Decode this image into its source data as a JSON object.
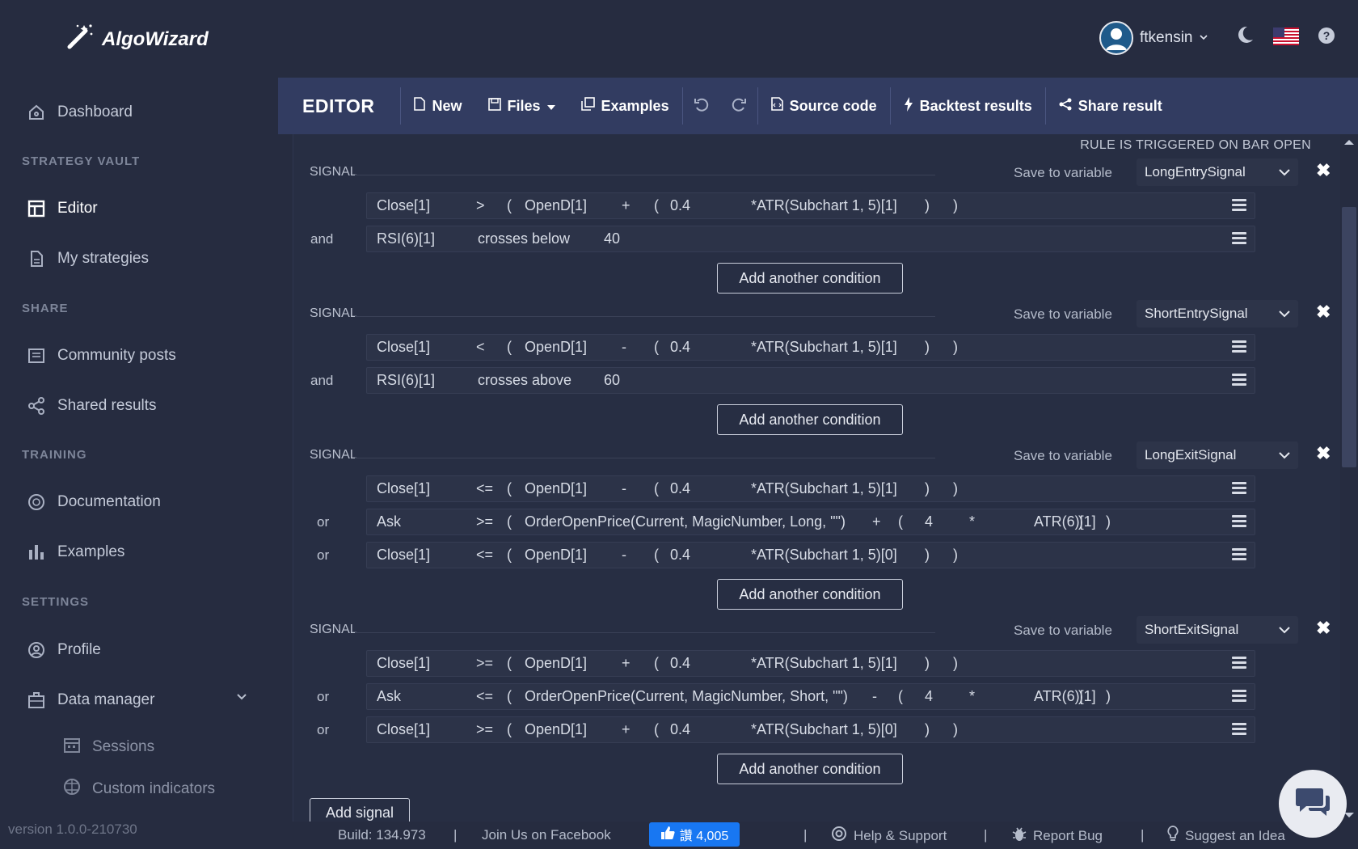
{
  "brand": {
    "name": "AlgoWizard"
  },
  "sidebar": {
    "items": [
      {
        "label": "Dashboard"
      },
      {
        "section": "STRATEGY VAULT"
      },
      {
        "label": "Editor"
      },
      {
        "label": "My strategies"
      },
      {
        "section": "SHARE"
      },
      {
        "label": "Community posts"
      },
      {
        "label": "Shared results"
      },
      {
        "section": "TRAINING"
      },
      {
        "label": "Documentation"
      },
      {
        "label": "Examples"
      },
      {
        "section": "SETTINGS"
      },
      {
        "label": "Profile"
      },
      {
        "label": "Data manager"
      },
      {
        "label": "Sessions"
      },
      {
        "label": "Custom indicators"
      }
    ],
    "version": "version 1.0.0-210730"
  },
  "header": {
    "username": "ftkensin"
  },
  "toolbar": {
    "title": "EDITOR",
    "new": "New",
    "files": "Files",
    "examples": "Examples",
    "source": "Source code",
    "backtest": "Backtest results",
    "share": "Share result"
  },
  "editor": {
    "trigger_note": "RULE IS TRIGGERED ON BAR OPEN",
    "signal_label": "SIGNAL",
    "save_label": "Save to variable",
    "add_condition": "Add another condition",
    "add_signal": "Add signal",
    "signals": [
      {
        "variable": "LongEntrySignal",
        "conditions": [
          {
            "conj": "",
            "tokens": [
              "Close[1]",
              ">",
              "(",
              "OpenD[1]",
              "+",
              "(",
              "0.4",
              "*",
              "ATR(Subchart 1, 5)[1]",
              ")",
              ")"
            ]
          },
          {
            "conj": "and",
            "tokens": [
              "RSI(6)[1]",
              "crosses below",
              "40"
            ]
          }
        ]
      },
      {
        "variable": "ShortEntrySignal",
        "conditions": [
          {
            "conj": "",
            "tokens": [
              "Close[1]",
              "<",
              "(",
              "OpenD[1]",
              "-",
              "(",
              "0.4",
              "*",
              "ATR(Subchart 1, 5)[1]",
              ")",
              ")"
            ]
          },
          {
            "conj": "and",
            "tokens": [
              "RSI(6)[1]",
              "crosses above",
              "60"
            ]
          }
        ]
      },
      {
        "variable": "LongExitSignal",
        "conditions": [
          {
            "conj": "",
            "tokens": [
              "Close[1]",
              "<=",
              "(",
              "OpenD[1]",
              "-",
              "(",
              "0.4",
              "*",
              "ATR(Subchart 1, 5)[1]",
              ")",
              ")"
            ]
          },
          {
            "conj": "or",
            "tokens": [
              "Ask",
              ">=",
              "(",
              "OrderOpenPrice(Current, MagicNumber, Long, \"\")",
              "+",
              "(",
              "4",
              "*",
              "ATR(6)[1]",
              ")",
              ")"
            ]
          },
          {
            "conj": "or",
            "tokens": [
              "Close[1]",
              "<=",
              "(",
              "OpenD[1]",
              "-",
              "(",
              "0.4",
              "*",
              "ATR(Subchart 1, 5)[0]",
              ")",
              ")"
            ]
          }
        ]
      },
      {
        "variable": "ShortExitSignal",
        "conditions": [
          {
            "conj": "",
            "tokens": [
              "Close[1]",
              ">=",
              "(",
              "OpenD[1]",
              "+",
              "(",
              "0.4",
              "*",
              "ATR(Subchart 1, 5)[1]",
              ")",
              ")"
            ]
          },
          {
            "conj": "or",
            "tokens": [
              "Ask",
              "<=",
              "(",
              "OrderOpenPrice(Current, MagicNumber, Short, \"\")",
              "-",
              "(",
              "4",
              "*",
              "ATR(6)[1]",
              ")",
              ")"
            ]
          },
          {
            "conj": "or",
            "tokens": [
              "Close[1]",
              ">=",
              "(",
              "OpenD[1]",
              "+",
              "(",
              "0.4",
              "*",
              "ATR(Subchart 1, 5)[0]",
              ")",
              ")"
            ]
          }
        ]
      }
    ]
  },
  "footer": {
    "build": "Build: 134.973",
    "facebook": "Join Us on Facebook",
    "like": "讚 4,005",
    "help": "Help & Support",
    "bug": "Report Bug",
    "idea": "Suggest an Idea",
    "sep": "|"
  }
}
